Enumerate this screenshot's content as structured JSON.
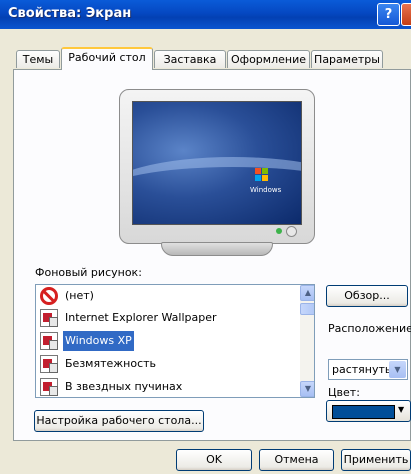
{
  "window": {
    "title": "Свойства: Экран",
    "help_label": "?"
  },
  "tabs": [
    {
      "label": "Темы"
    },
    {
      "label": "Рабочий стол"
    },
    {
      "label": "Заставка"
    },
    {
      "label": "Оформление"
    },
    {
      "label": "Параметры"
    }
  ],
  "preview": {
    "logo_text": "Windows"
  },
  "background": {
    "label": "Фоновый рисунок:",
    "items": [
      {
        "label": "(нет)",
        "icon": "none-icon"
      },
      {
        "label": "Internet Explorer Wallpaper",
        "icon": "picture-icon"
      },
      {
        "label": "Windows XP",
        "icon": "picture-icon",
        "selected": true
      },
      {
        "label": "Безмятежность",
        "icon": "picture-icon"
      },
      {
        "label": "В звездных пучинах",
        "icon": "picture-icon"
      }
    ],
    "browse_label": "Обзор...",
    "position_label": "Расположение:",
    "position_value": "растянуть",
    "color_label": "Цвет:",
    "color_value": "#004e98"
  },
  "customize_label": "Настройка рабочего стола...",
  "footer": {
    "ok_label": "OK",
    "cancel_label": "Отмена",
    "apply_label": "Применить"
  }
}
